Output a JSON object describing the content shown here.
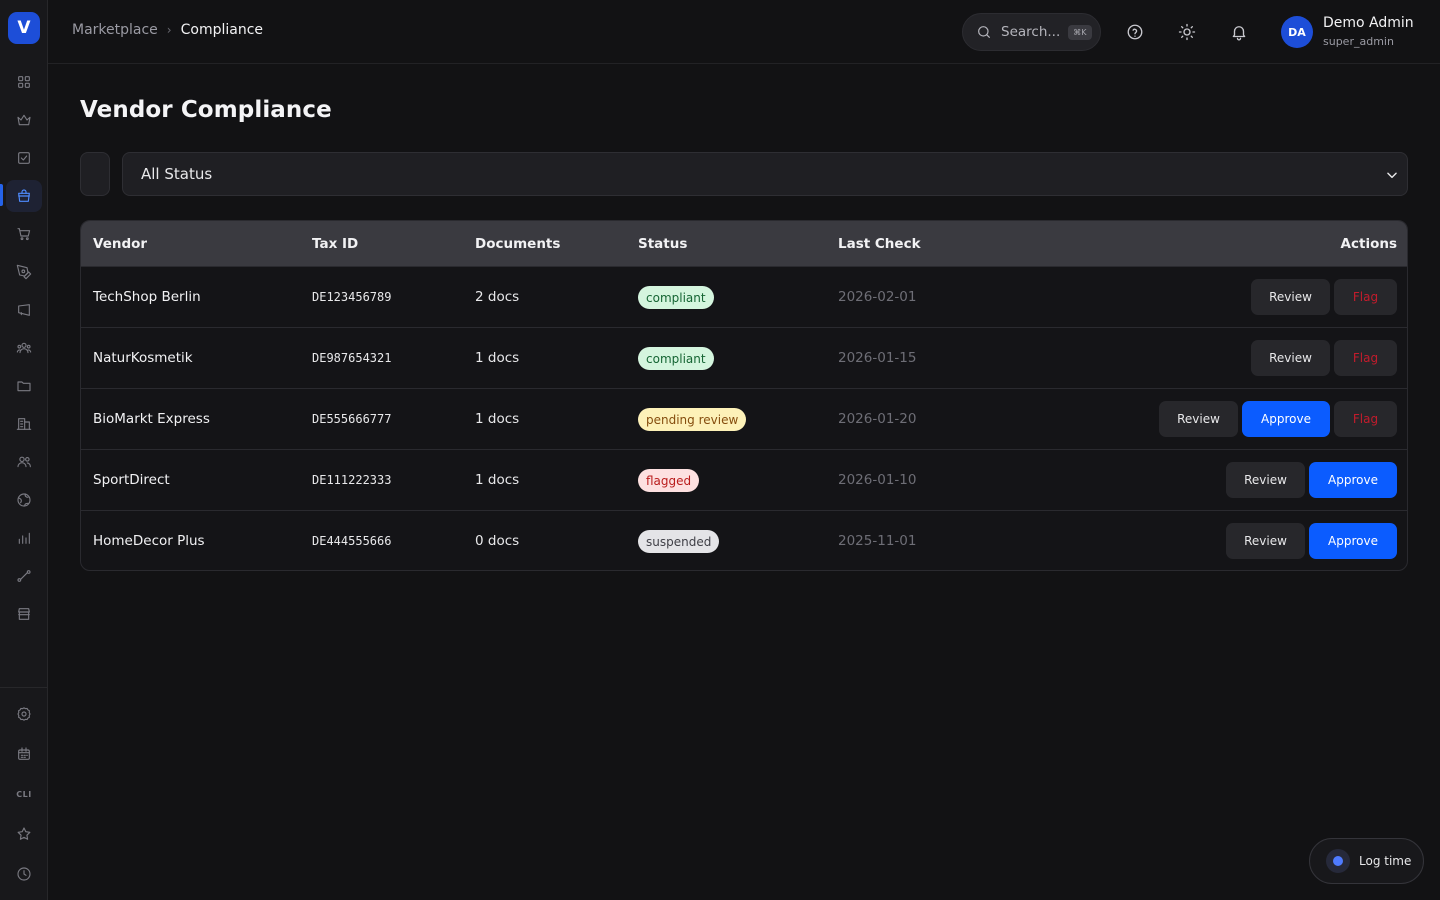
{
  "app": {
    "logo_letter": "V",
    "accent": "#1d4ed8"
  },
  "sidebar": {
    "items": [
      {
        "icon": "grid-icon"
      },
      {
        "icon": "crown-icon"
      },
      {
        "icon": "checkbox-icon"
      },
      {
        "icon": "shopping-bag-icon",
        "active": true
      },
      {
        "icon": "cart-icon"
      },
      {
        "icon": "pen-tool-icon"
      },
      {
        "icon": "megaphone-icon"
      },
      {
        "icon": "users-group-icon"
      },
      {
        "icon": "folder-icon"
      },
      {
        "icon": "building-icon"
      },
      {
        "icon": "users-icon"
      },
      {
        "icon": "globe-icon"
      },
      {
        "icon": "bar-chart-icon"
      },
      {
        "icon": "route-icon"
      },
      {
        "icon": "store-icon"
      }
    ],
    "bottom_items": [
      {
        "icon": "gear-icon"
      },
      {
        "icon": "calendar-icon"
      },
      {
        "icon": "cli-icon",
        "label": "CLI"
      },
      {
        "icon": "star-icon"
      },
      {
        "icon": "clock-icon"
      }
    ]
  },
  "header": {
    "breadcrumb": {
      "parent": "Marketplace",
      "current": "Compliance"
    },
    "search": {
      "placeholder": "Search...",
      "shortcut": "⌘K"
    },
    "user": {
      "initials": "DA",
      "name": "Demo Admin",
      "role": "super_admin"
    }
  },
  "main": {
    "title": "Vendor Compliance",
    "filter": {
      "selected": "All Status"
    },
    "table": {
      "columns": [
        "Vendor",
        "Tax ID",
        "Documents",
        "Status",
        "Last Check",
        "Actions"
      ],
      "rows": [
        {
          "vendor": "TechShop Berlin",
          "tax_id": "DE123456789",
          "documents": "2 docs",
          "status": "compliant",
          "last_check": "2026-02-01",
          "actions": [
            "Review",
            "Flag"
          ]
        },
        {
          "vendor": "NaturKosmetik",
          "tax_id": "DE987654321",
          "documents": "1 docs",
          "status": "compliant",
          "last_check": "2026-01-15",
          "actions": [
            "Review",
            "Flag"
          ]
        },
        {
          "vendor": "BioMarkt Express",
          "tax_id": "DE555666777",
          "documents": "1 docs",
          "status": "pending review",
          "last_check": "2026-01-20",
          "actions": [
            "Review",
            "Approve",
            "Flag"
          ]
        },
        {
          "vendor": "SportDirect",
          "tax_id": "DE111222333",
          "documents": "1 docs",
          "status": "flagged",
          "last_check": "2026-01-10",
          "actions": [
            "Review",
            "Approve"
          ]
        },
        {
          "vendor": "HomeDecor Plus",
          "tax_id": "DE444555666",
          "documents": "0 docs",
          "status": "suspended",
          "last_check": "2025-11-01",
          "actions": [
            "Review",
            "Approve"
          ]
        }
      ]
    }
  },
  "floating": {
    "log_time_label": "Log time"
  }
}
